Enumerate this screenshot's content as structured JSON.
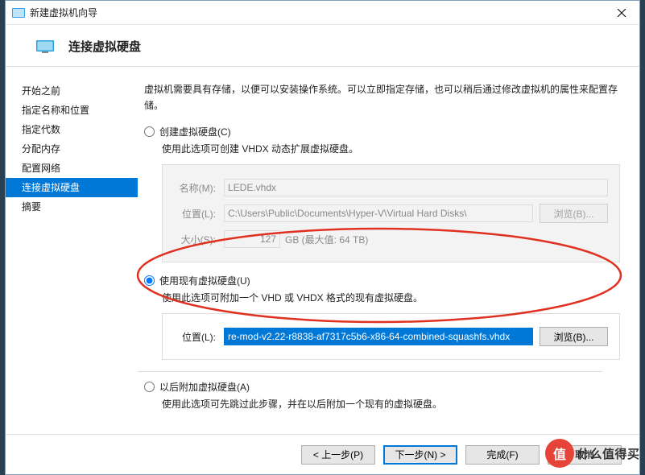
{
  "window": {
    "title": "新建虚拟机向导"
  },
  "header": {
    "title": "连接虚拟硬盘"
  },
  "sidebar": {
    "items": [
      {
        "label": "开始之前"
      },
      {
        "label": "指定名称和位置"
      },
      {
        "label": "指定代数"
      },
      {
        "label": "分配内存"
      },
      {
        "label": "配置网络"
      },
      {
        "label": "连接虚拟硬盘"
      },
      {
        "label": "摘要"
      }
    ],
    "active_index": 5
  },
  "content": {
    "description": "虚拟机需要具有存储，以便可以安装操作系统。可以立即指定存储，也可以稍后通过修改虚拟机的属性来配置存储。",
    "option_create": {
      "label": "创建虚拟硬盘(C)",
      "desc": "使用此选项可创建 VHDX 动态扩展虚拟硬盘。",
      "name_label": "名称(M):",
      "name_value": "LEDE.vhdx",
      "location_label": "位置(L):",
      "location_value": "C:\\Users\\Public\\Documents\\Hyper-V\\Virtual Hard Disks\\",
      "browse_label": "浏览(B)...",
      "size_label": "大小(S):",
      "size_value": "127",
      "size_hint": "GB (最大值: 64 TB)"
    },
    "option_existing": {
      "label": "使用现有虚拟硬盘(U)",
      "desc": "使用此选项可附加一个 VHD 或 VHDX 格式的现有虚拟硬盘。",
      "location_label": "位置(L):",
      "location_value": "re-mod-v2.22-r8838-af7317c5b6-x86-64-combined-squashfs.vhdx",
      "browse_label": "浏览(B)..."
    },
    "option_later": {
      "label": "以后附加虚拟硬盘(A)",
      "desc": "使用此选项可先跳过此步骤，并在以后附加一个现有的虚拟硬盘。"
    }
  },
  "footer": {
    "prev": "< 上一步(P)",
    "next": "下一步(N) >",
    "finish": "完成(F)",
    "cancel": "取消"
  },
  "watermark": {
    "badge": "值",
    "text": "什么值得买"
  }
}
